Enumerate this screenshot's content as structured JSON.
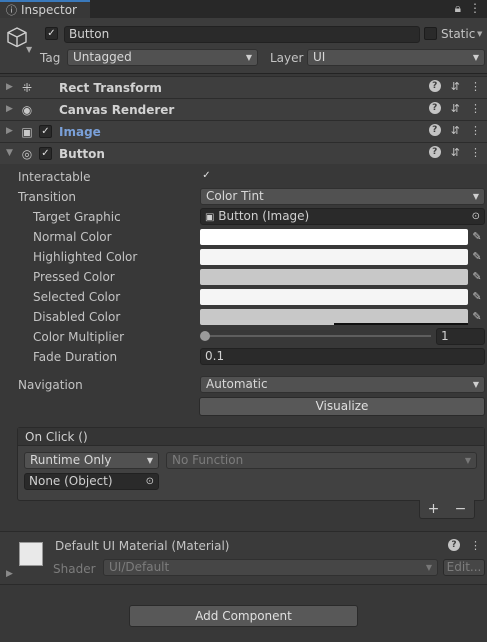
{
  "tab": {
    "title": "Inspector",
    "lock_icon": "lock-icon",
    "menu_icon": "kebab-menu-icon"
  },
  "header": {
    "name": "Button",
    "static_label": "Static",
    "tag_label": "Tag",
    "tag_value": "Untagged",
    "layer_label": "Layer",
    "layer_value": "UI"
  },
  "components": [
    {
      "title": "Rect Transform",
      "icon": "rect-transform-icon"
    },
    {
      "title": "Canvas Renderer",
      "icon": "eye-icon"
    },
    {
      "title": "Image",
      "icon": "image-icon",
      "enabled": true
    },
    {
      "title": "Button",
      "icon": "button-icon",
      "enabled": true
    }
  ],
  "button_props": {
    "interactable_label": "Interactable",
    "transition_label": "Transition",
    "transition_value": "Color Tint",
    "target_graphic_label": "Target Graphic",
    "target_graphic_value": "Button (Image)",
    "normal_color_label": "Normal Color",
    "highlighted_color_label": "Highlighted Color",
    "pressed_color_label": "Pressed Color",
    "selected_color_label": "Selected Color",
    "disabled_color_label": "Disabled Color",
    "color_multiplier_label": "Color Multiplier",
    "color_multiplier_value": "1",
    "fade_duration_label": "Fade Duration",
    "fade_duration_value": "0.1",
    "navigation_label": "Navigation",
    "navigation_value": "Automatic",
    "visualize_label": "Visualize"
  },
  "colors": {
    "normal": "#ffffff",
    "highlighted": "#f5f5f5",
    "pressed": "#c8c8c8",
    "selected": "#f5f5f5",
    "disabled": "#c8c8c8"
  },
  "onclick": {
    "title": "On Click ()",
    "runtime_value": "Runtime Only",
    "function_value": "No Function",
    "object_value": "None (Object)",
    "add_label": "+",
    "remove_label": "−"
  },
  "material": {
    "title": "Default UI Material (Material)",
    "shader_label": "Shader",
    "shader_value": "UI/Default",
    "edit_label": "Edit..."
  },
  "add_component_label": "Add Component"
}
